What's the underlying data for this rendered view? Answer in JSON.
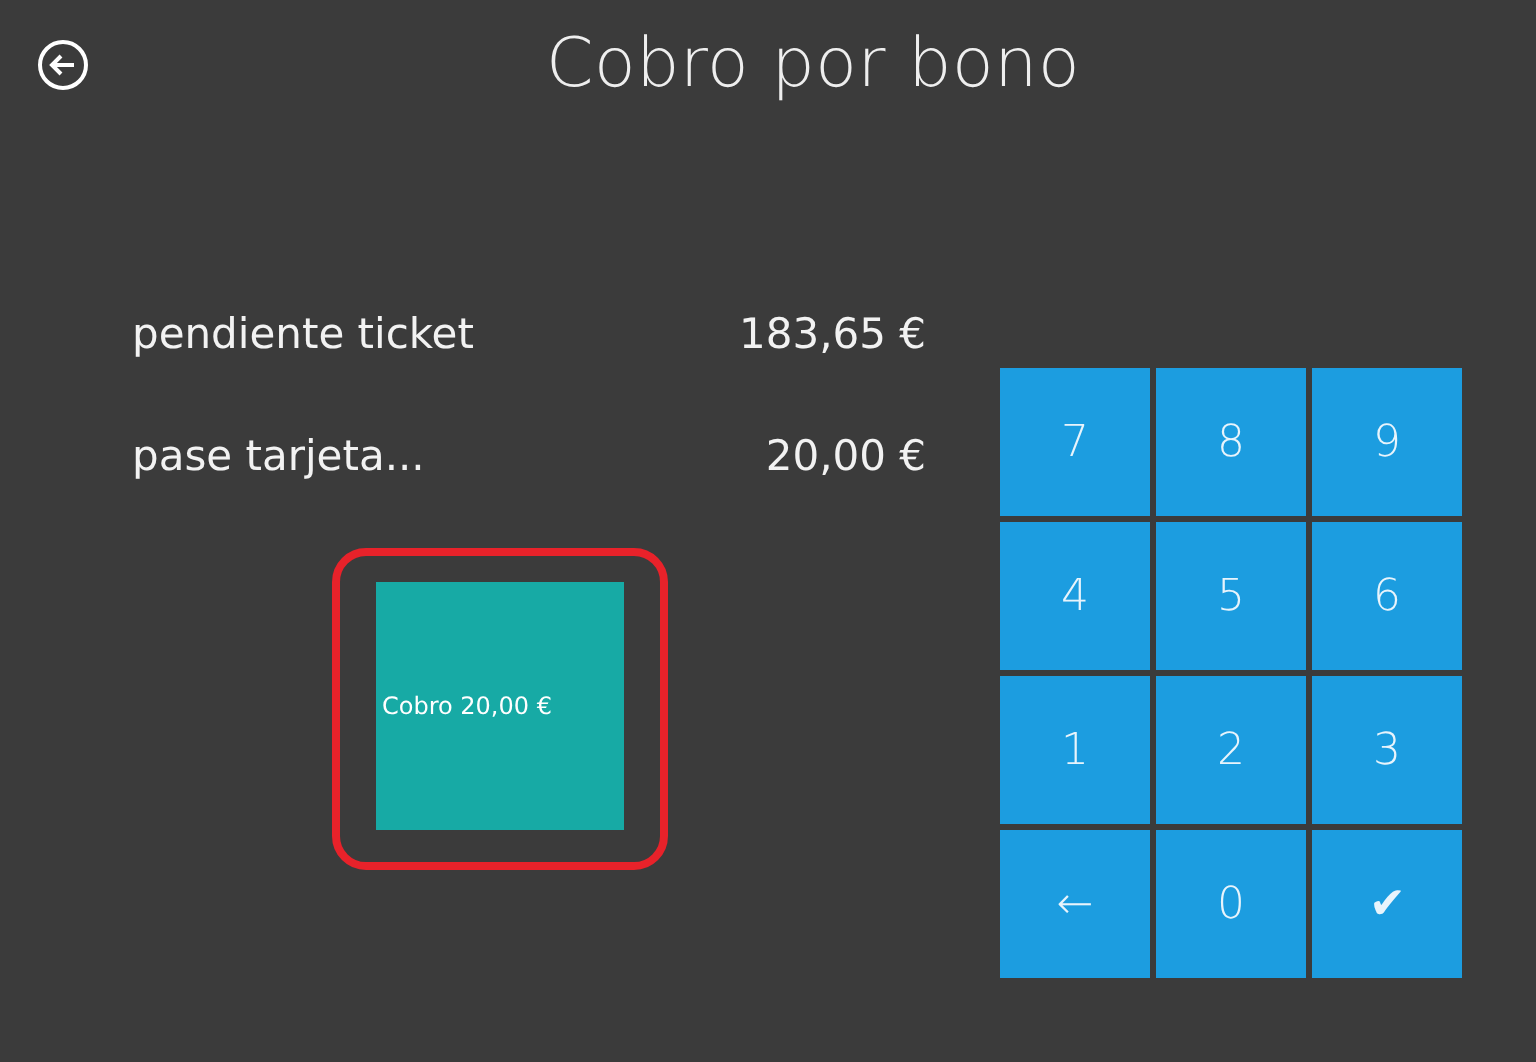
{
  "header": {
    "title": "Cobro por bono"
  },
  "summary": [
    {
      "label": "pendiente ticket",
      "amount": "183,65 €"
    },
    {
      "label": "pase tarjeta...",
      "amount": "20,00 €"
    }
  ],
  "tile": {
    "label": "Cobro 20,00 €",
    "highlighted": true
  },
  "keypad": [
    "7",
    "8",
    "9",
    "4",
    "5",
    "6",
    "1",
    "2",
    "3",
    "←",
    "0",
    "✔"
  ]
}
